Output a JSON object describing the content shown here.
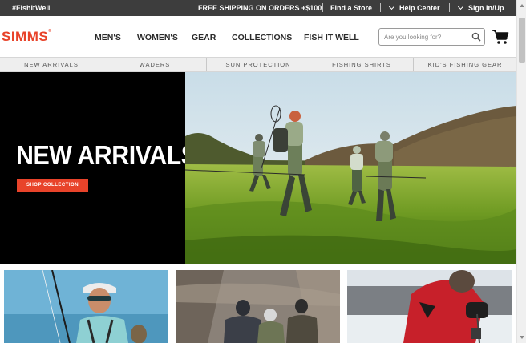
{
  "topbar": {
    "hashtag": "#FishItWell",
    "shipping": "FREE SHIPPING ON ORDERS +$100",
    "find_store": "Find a Store",
    "help_center": "Help Center",
    "sign_in": "Sign In/Up"
  },
  "header": {
    "logo": "SIMMS",
    "nav": [
      "MEN'S",
      "WOMEN'S",
      "GEAR",
      "COLLECTIONS",
      "FISH IT WELL"
    ],
    "search_placeholder": "Are you looking for?"
  },
  "subnav": [
    "NEW ARRIVALS",
    "WADERS",
    "SUN PROTECTION",
    "FISHING SHIRTS",
    "KID'S FISHING GEAR"
  ],
  "hero": {
    "title": "NEW ARRIVALS",
    "button": "SHOP COLLECTION"
  },
  "icons": {
    "search": "search-icon",
    "cart": "cart-icon",
    "help_chevron": "chevron-down-icon",
    "signin_chevron": "chevron-down-icon"
  },
  "colors": {
    "brand": "#e8432a",
    "topbar": "#3d3d3d"
  }
}
